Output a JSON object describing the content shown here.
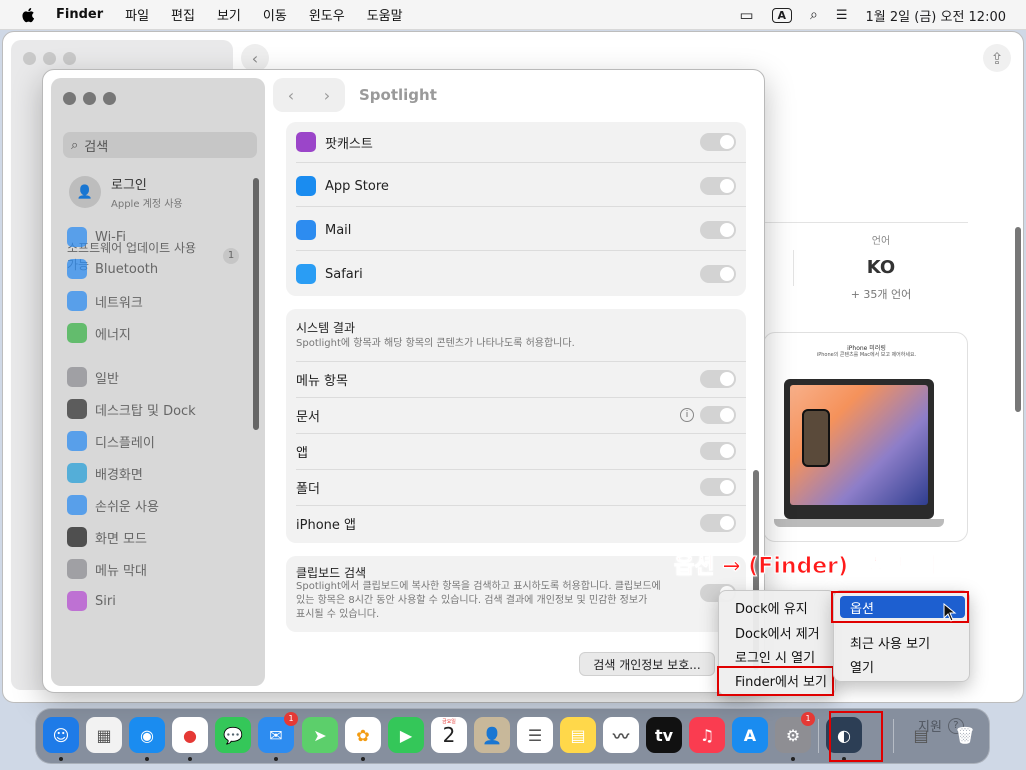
{
  "menubar": {
    "app_name": "Finder",
    "items": [
      "파일",
      "편집",
      "보기",
      "이동",
      "윈도우",
      "도움말"
    ],
    "input_source": "A",
    "clock": "1월 2일 (금) 오전 12:00"
  },
  "background_window": {
    "language_label": "언어",
    "language_value": "KO",
    "language_more": "+ 35개 언어",
    "promo_title": "iPhone 미러링",
    "promo_subtitle": "iPhone의 콘텐츠를 Mac에서 보고 제어하세요.",
    "support_label": "지원",
    "support_icon": "question-icon"
  },
  "settings": {
    "title": "Spotlight",
    "search_placeholder": "검색",
    "account_name": "로그인",
    "account_sub": "Apple 계정 사용",
    "update_text": "소프트웨어 업데이트 사용 가능",
    "update_badge": "1",
    "sidebar_items": [
      {
        "label": "Wi-Fi",
        "color": "#2d8cf0"
      },
      {
        "label": "Bluetooth",
        "color": "#2d8cf0"
      },
      {
        "label": "네트워크",
        "color": "#2d8cf0"
      },
      {
        "label": "에너지",
        "color": "#3cb34a"
      },
      {
        "label": "일반",
        "color": "#8e8e93"
      },
      {
        "label": "데스크탑 및 Dock",
        "color": "#333333"
      },
      {
        "label": "디스플레이",
        "color": "#2d8cf0"
      },
      {
        "label": "배경화면",
        "color": "#28a0d8"
      },
      {
        "label": "손쉬운 사용",
        "color": "#2d8cf0"
      },
      {
        "label": "화면 모드",
        "color": "#222222"
      },
      {
        "label": "메뉴 막대",
        "color": "#8e8e93"
      },
      {
        "label": "Siri",
        "color": "#b54fd1"
      }
    ],
    "app_rows": [
      {
        "label": "팟캐스트",
        "color": "#9b45c9"
      },
      {
        "label": "App Store",
        "color": "#1a8cf0"
      },
      {
        "label": "Mail",
        "color": "#2d8cf0"
      },
      {
        "label": "Safari",
        "color": "#2a9df4"
      }
    ],
    "system_results": {
      "heading": "시스템 결과",
      "description": "Spotlight에 항목과 해당 항목의 콘텐츠가 나타나도록 허용합니다.",
      "rows": [
        "메뉴 항목",
        "문서",
        "앱",
        "폴더",
        "iPhone 앱"
      ]
    },
    "clipboard": {
      "heading": "클립보드 검색",
      "description_1": "Spotlight에서 클립보드에 복사한 항목을 검색하고 표시하도록 허용합니다. 클립보드에",
      "description_2": "있는 항목은 8시간 동안 사용할 수 있습니다. 검색 결과에 개인정보 및 민감한 정보가",
      "description_3": "표시될 수 있습니다."
    },
    "privacy_button": "검색 개인정보 보호..."
  },
  "context_menu": {
    "items": [
      "Dock에 유지",
      "Dock에서 제거",
      "로그인 시 열기",
      "Finder에서 보기"
    ]
  },
  "submenu": {
    "items": [
      "옵션",
      "최근 사용 보기",
      "열기"
    ]
  },
  "callout": "옵션 → (Finder)에서 보기",
  "dock": {
    "apps": [
      {
        "name": "finder-icon",
        "color": "#1e7be8",
        "glyph": "☺"
      },
      {
        "name": "launchpad-icon",
        "color": "#f2f2f2",
        "glyph": "▦"
      },
      {
        "name": "safari-icon",
        "color": "#1a8cf0",
        "glyph": "◉"
      },
      {
        "name": "chrome-icon",
        "color": "#ffffff",
        "glyph": "●"
      },
      {
        "name": "messages-icon",
        "color": "#34c759",
        "glyph": "💬"
      },
      {
        "name": "mail-icon",
        "color": "#2d8cf0",
        "glyph": "✉",
        "badge": "1"
      },
      {
        "name": "maps-icon",
        "color": "#5ccf6b",
        "glyph": "➤"
      },
      {
        "name": "photos-icon",
        "color": "#ffffff",
        "glyph": "✿"
      },
      {
        "name": "facetime-icon",
        "color": "#34c759",
        "glyph": "▶"
      },
      {
        "name": "calendar-icon",
        "color": "#ffffff",
        "glyph": "2"
      },
      {
        "name": "contacts-icon",
        "color": "#c8b89a",
        "glyph": "👤"
      },
      {
        "name": "reminders-icon",
        "color": "#ffffff",
        "glyph": "☰"
      },
      {
        "name": "notes-icon",
        "color": "#ffd84a",
        "glyph": "▤"
      },
      {
        "name": "freeform-icon",
        "color": "#ffffff",
        "glyph": "〰"
      },
      {
        "name": "appletv-icon",
        "color": "#111111",
        "glyph": "tv"
      },
      {
        "name": "music-icon",
        "color": "#fa3c50",
        "glyph": "♫"
      },
      {
        "name": "appstore-icon",
        "color": "#1a8cf0",
        "glyph": "A"
      },
      {
        "name": "systemsettings-icon",
        "color": "#8e8e93",
        "glyph": "⚙",
        "badge": "1"
      },
      {
        "name": "target-app-icon",
        "color": "#2c3e55",
        "glyph": "◐"
      },
      {
        "name": "document-icon",
        "color": "#f5f5f5",
        "glyph": "▤"
      },
      {
        "name": "trash-icon",
        "color": "#d9d9d9",
        "glyph": "🗑"
      }
    ],
    "calendar_month": "금요일"
  }
}
